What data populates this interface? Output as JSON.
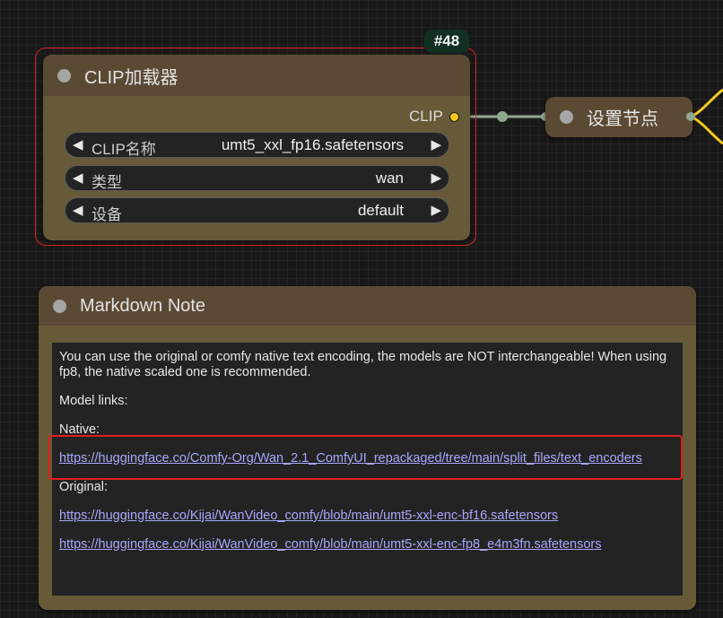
{
  "canvas": {
    "background": "#181818",
    "accent_selection": "#d8232a"
  },
  "clip_loader": {
    "id_badge": "#48",
    "title": "CLIP加载器",
    "output_label": "CLIP",
    "output_color": "#f2c81d",
    "widgets": [
      {
        "label": "CLIP名称",
        "value": "umt5_xxl_fp16.safetensors"
      },
      {
        "label": "类型",
        "value": "wan"
      },
      {
        "label": "设备",
        "value": "default"
      }
    ]
  },
  "set_node": {
    "title": "设置节点"
  },
  "markdown_note": {
    "title": "Markdown Note",
    "intro": "You can use the original or comfy native text encoding, the models are NOT interchangeable! When using fp8, the native scaled one is recommended.",
    "model_links_heading": "Model links:",
    "native_heading": "Native:",
    "native_link": "https://huggingface.co/Comfy-Org/Wan_2.1_ComfyUI_repackaged/tree/main/split_files/text_encoders",
    "original_heading": "Original:",
    "original_links": [
      "https://huggingface.co/Kijai/WanVideo_comfy/blob/main/umt5-xxl-enc-bf16.safetensors",
      "https://huggingface.co/Kijai/WanVideo_comfy/blob/main/umt5-xxl-enc-fp8_e4m3fn.safetensors"
    ]
  }
}
